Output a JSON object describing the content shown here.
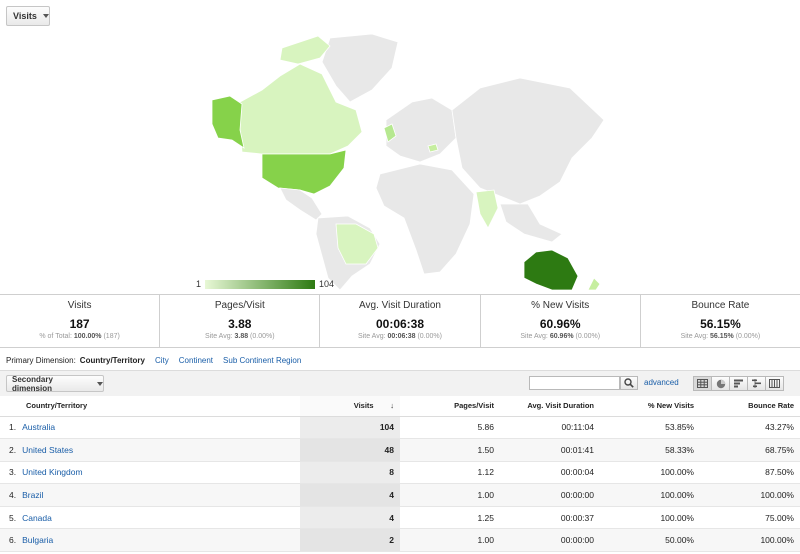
{
  "metric_select": {
    "label": "Visits"
  },
  "map": {
    "legend_min": "1",
    "legend_max": "104",
    "colors": {
      "max": "#2d7a12",
      "mid": "#86d24a",
      "low": "#d8f4bf",
      "none": "#e8e8e8"
    }
  },
  "summary": [
    {
      "label": "Visits",
      "value": "187",
      "sub_prefix": "% of Total: ",
      "sub_bold": "100.00%",
      "sub_suffix": " (187)"
    },
    {
      "label": "Pages/Visit",
      "value": "3.88",
      "sub_prefix": "Site Avg: ",
      "sub_bold": "3.88",
      "sub_suffix": " (0.00%)"
    },
    {
      "label": "Avg. Visit Duration",
      "value": "00:06:38",
      "sub_prefix": "Site Avg: ",
      "sub_bold": "00:06:38",
      "sub_suffix": " (0.00%)"
    },
    {
      "label": "% New Visits",
      "value": "60.96%",
      "sub_prefix": "Site Avg: ",
      "sub_bold": "60.96%",
      "sub_suffix": " (0.00%)"
    },
    {
      "label": "Bounce Rate",
      "value": "56.15%",
      "sub_prefix": "Site Avg: ",
      "sub_bold": "56.15%",
      "sub_suffix": " (0.00%)"
    }
  ],
  "dimensions": {
    "label": "Primary Dimension:",
    "current": "Country/Territory",
    "links": [
      "City",
      "Continent",
      "Sub Continent Region"
    ]
  },
  "toolbar": {
    "secondary_label": "Secondary dimension",
    "search_value": "",
    "advanced_label": "advanced"
  },
  "table": {
    "headers": [
      "Country/Territory",
      "Visits",
      "Pages/Visit",
      "Avg. Visit Duration",
      "% New Visits",
      "Bounce Rate"
    ],
    "sort_indicator": "↓",
    "rows": [
      {
        "idx": "1.",
        "country": "Australia",
        "visits": "104",
        "pages": "5.86",
        "duration": "00:11:04",
        "new": "53.85%",
        "bounce": "43.27%"
      },
      {
        "idx": "2.",
        "country": "United States",
        "visits": "48",
        "pages": "1.50",
        "duration": "00:01:41",
        "new": "58.33%",
        "bounce": "68.75%"
      },
      {
        "idx": "3.",
        "country": "United Kingdom",
        "visits": "8",
        "pages": "1.12",
        "duration": "00:00:04",
        "new": "100.00%",
        "bounce": "87.50%"
      },
      {
        "idx": "4.",
        "country": "Brazil",
        "visits": "4",
        "pages": "1.00",
        "duration": "00:00:00",
        "new": "100.00%",
        "bounce": "100.00%"
      },
      {
        "idx": "5.",
        "country": "Canada",
        "visits": "4",
        "pages": "1.25",
        "duration": "00:00:37",
        "new": "100.00%",
        "bounce": "75.00%"
      },
      {
        "idx": "6.",
        "country": "Bulgaria",
        "visits": "2",
        "pages": "1.00",
        "duration": "00:00:00",
        "new": "50.00%",
        "bounce": "100.00%"
      }
    ]
  }
}
